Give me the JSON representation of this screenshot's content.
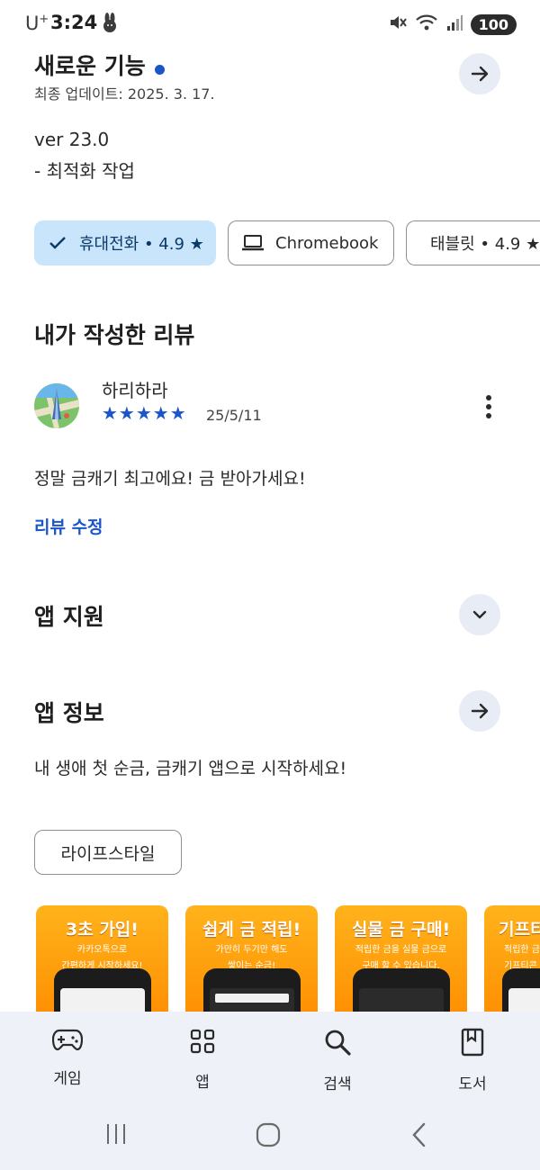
{
  "status": {
    "carrier": "U",
    "carrier_sup": "+",
    "time": "3:24",
    "battery": "100"
  },
  "whats_new": {
    "title": "새로운 기능",
    "updated": "최종 업데이트: 2025. 3. 17.",
    "version": "ver 23.0",
    "note": "- 최적화 작업"
  },
  "device_chips": [
    {
      "label": "휴대전화 • 4.9 ★",
      "icon": "check-icon",
      "selected": true
    },
    {
      "label": "Chromebook",
      "icon": "laptop-icon",
      "selected": false
    },
    {
      "label": "태블릿 • 4.9 ★",
      "icon": "tablet-icon",
      "selected": false
    }
  ],
  "my_review": {
    "heading": "내가 작성한 리뷰",
    "user_name": "하리하라",
    "stars": "★★★★★",
    "date": "25/5/11",
    "text": "정말 금캐기 최고에요! 금 받아가세요!",
    "edit_link": "리뷰 수정"
  },
  "app_support": {
    "heading": "앱 지원"
  },
  "app_info": {
    "heading": "앱 정보",
    "description": "내 생애 첫 순금, 금캐기 앱으로 시작하세요!",
    "tag": "라이프스타일"
  },
  "screenshots": [
    {
      "title": "3초 가입!",
      "sub1": "카카오톡으로",
      "sub2": "간편하게 시작하세요!"
    },
    {
      "title": "쉽게 금 적립!",
      "sub1": "가만히 두기만 해도",
      "sub2": "쌓이는 순금!"
    },
    {
      "title": "실물 금 구매!",
      "sub1": "적립한 금을 실물 금으로",
      "sub2": "구매 할 수 있습니다."
    },
    {
      "title": "기프티",
      "sub1": "적립한 금",
      "sub2": "기프티콘"
    }
  ],
  "bottom_nav": [
    {
      "label": "게임",
      "icon": "gamepad-icon"
    },
    {
      "label": "앱",
      "icon": "apps-grid-icon"
    },
    {
      "label": "검색",
      "icon": "search-icon"
    },
    {
      "label": "도서",
      "icon": "book-icon"
    }
  ],
  "colors": {
    "accent": "#1a55c9",
    "chip_selected": "#c8e5fb",
    "circle_button": "#e7ecf5",
    "screenshot_orange": "#ff9a0d",
    "nav_background": "#eef1f7"
  }
}
